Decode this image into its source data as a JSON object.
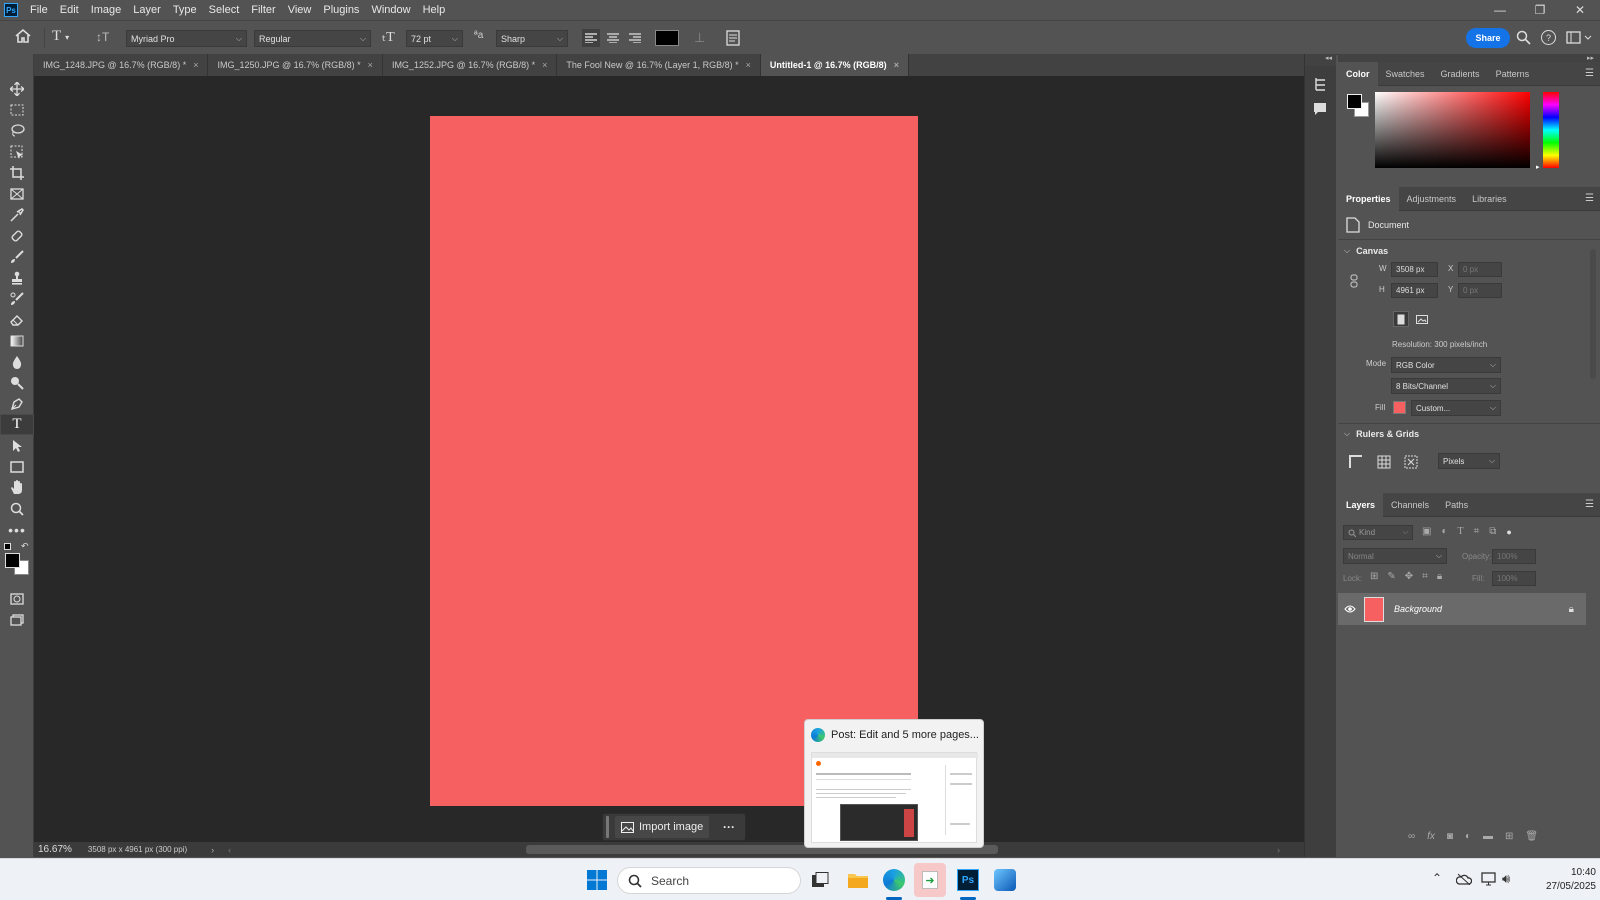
{
  "app": {
    "logo": "Ps"
  },
  "menu": [
    "File",
    "Edit",
    "Image",
    "Layer",
    "Type",
    "Select",
    "Filter",
    "View",
    "Plugins",
    "Window",
    "Help"
  ],
  "options": {
    "font_family": "Myriad Pro",
    "font_style": "Regular",
    "font_size": "72 pt",
    "antialias": "Sharp",
    "share_label": "Share",
    "text_color": "#000000"
  },
  "tabs": [
    {
      "label": "IMG_1248.JPG @ 16.7% (RGB/8) *"
    },
    {
      "label": "IMG_1250.JPG @ 16.7% (RGB/8) *"
    },
    {
      "label": "IMG_1252.JPG @ 16.7% (RGB/8) *"
    },
    {
      "label": "The Fool New @ 16.7% (Layer 1, RGB/8) *"
    },
    {
      "label": "Untitled-1 @ 16.7% (RGB/8)"
    }
  ],
  "close_glyph": "×",
  "document": {
    "fill_color": "#f76060"
  },
  "status": {
    "zoom": "16.67%",
    "info": "3508 px x 4961 px (300 ppi)"
  },
  "color_panel": {
    "tabs": [
      "Color",
      "Swatches",
      "Gradients",
      "Patterns"
    ]
  },
  "properties": {
    "tabs": [
      "Properties",
      "Adjustments",
      "Libraries"
    ],
    "doc_label": "Document",
    "canvas_title": "Canvas",
    "w_label": "W",
    "w_value": "3508 px",
    "h_label": "H",
    "h_value": "4961 px",
    "x_label": "X",
    "x_value": "0 px",
    "y_label": "Y",
    "y_value": "0 px",
    "resolution": "Resolution: 300 pixels/inch",
    "mode_label": "Mode",
    "mode_value": "RGB Color",
    "bits_value": "8 Bits/Channel",
    "fill_label": "Fill",
    "fill_value": "Custom...",
    "rulers_title": "Rulers & Grids",
    "units_value": "Pixels"
  },
  "layers": {
    "tabs": [
      "Layers",
      "Channels",
      "Paths"
    ],
    "kind_placeholder": "Kind",
    "blend": "Normal",
    "opacity_label": "Opacity:",
    "opacity_value": "100%",
    "lock_label": "Lock:",
    "fill_label": "Fill:",
    "fill_value": "100%",
    "layer_name": "Background"
  },
  "popup": {
    "title": "Post: Edit and 5 more pages..."
  },
  "import_label": "Import image",
  "more_label": "···",
  "taskbar": {
    "search": "Search",
    "time": "10:40",
    "date": "27/05/2025"
  }
}
